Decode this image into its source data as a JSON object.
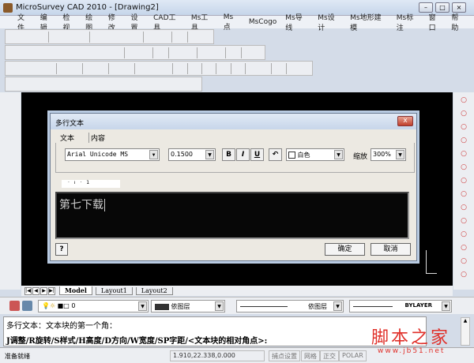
{
  "window": {
    "title": "MicroSurvey CAD 2010 - [Drawing2]"
  },
  "menu": [
    "文件",
    "编辑",
    "检视",
    "绘图",
    "修改",
    "设置",
    "CAD工具",
    "Ms工具",
    "Ms点",
    "MsCogo",
    "Ms导线",
    "Ms设计",
    "Ms地形建模",
    "Ms标注",
    "窗口",
    "帮助"
  ],
  "toolbars": [
    [
      "new-icon",
      "open-icon",
      "save-icon",
      "|",
      "print-icon",
      "preview-icon",
      "brush-icon",
      "|",
      "cut-icon",
      "copy-icon",
      "paste-icon",
      "match-icon",
      "|",
      "undo-icon",
      "redo-icon",
      "|",
      "delete-icon",
      "|",
      "help-icon"
    ],
    [
      "line-icon",
      "zoom-icon",
      "arc-icon",
      "pick-icon",
      "tool-icon",
      "tool2-icon",
      "rect-icon",
      "house-icon",
      "poly-icon",
      "|",
      "circle-icon",
      "block-icon",
      "|",
      "layer-icon",
      "|",
      "layer2-icon",
      "text-line-icon",
      "|",
      "target-icon",
      "target2-icon",
      "|",
      "frame-icon",
      "|",
      "text-a-icon"
    ],
    [
      "copy-obj-icon",
      "array-icon",
      "rotate-obj-icon",
      "box-icon",
      "|",
      "rotate-ccw-icon",
      "rotate-cw-icon",
      "|",
      "mirror-icon",
      "mirror2-icon",
      "|",
      "grid-icon",
      "grid2-icon",
      "|",
      "rect1-icon",
      "rect2-icon",
      "rect3-icon",
      "|",
      "print2-icon",
      "|",
      "bar-icon",
      "|",
      "angle-icon",
      "|",
      "ruler-icon",
      "|",
      "slope-icon",
      "|",
      "find-icon",
      "paint-icon",
      "|",
      "pen-icon",
      "|",
      "stack-icon",
      "stack2-icon"
    ],
    [
      "pin-icon",
      "bag-icon",
      "bag2-icon",
      "check-icon",
      "bird-icon",
      "walk-icon",
      "line2-icon",
      "triangle-icon",
      "split-icon",
      "fr-icon",
      "c-box-icon",
      "t-box-icon",
      "image-icon",
      "pfd-icon",
      "lbl-icon",
      "battery-icon",
      "sqm-icon",
      "window-icon"
    ]
  ],
  "left_tools": [
    "pencil-icon",
    "eraser-icon",
    "zoom-in-icon",
    "zoom-out-icon",
    "pan-icon",
    "move-icon",
    "refresh-icon",
    "list-icon",
    "layer-icon",
    "print-icon",
    "dots-icon",
    "info-icon",
    "shape-icon",
    "angle-icon"
  ],
  "right_tools": [
    "circle-icon",
    "line-icon",
    "circle2-icon",
    "circle3-icon",
    "circle4-icon",
    "arc-icon",
    "arc2-icon",
    "rect-icon",
    "curve-icon",
    "curve2-icon",
    "polyline-icon",
    "hatch-icon",
    "cross-icon",
    "star-icon"
  ],
  "dialog": {
    "title": "多行文本",
    "tabs": [
      "文本",
      "内容"
    ],
    "font": "Arial Unicode MS",
    "height": "0.1500",
    "bold": "B",
    "italic": "I",
    "underline": "U",
    "color": "白色",
    "scale_label": "缩放",
    "scale": "300%",
    "ruler": "·  ı  ·  1",
    "text": "第七下载",
    "help": "?",
    "ok": "确定",
    "cancel": "取消"
  },
  "layout_tabs": [
    "Model",
    "Layout1",
    "Layout2"
  ],
  "props": {
    "layer": "0",
    "color": "依图层",
    "linetype": "依图层",
    "lineweight": "BYLAYER"
  },
  "command": {
    "line1": "多行文本：文本块的第一个角：",
    "line2": "J调整/R旋转/S样式/H高度/D方向/W宽度/SP字距/<文本块的相对角点>:"
  },
  "status": {
    "ready": "准备就绪",
    "coords": "1.910,22.338,0.000",
    "snap": "捕点设置",
    "grid": "网格",
    "ortho": "正交",
    "polar": "POLAR"
  },
  "watermark": {
    "text": "脚本之家",
    "url": "www.jb51.net"
  }
}
